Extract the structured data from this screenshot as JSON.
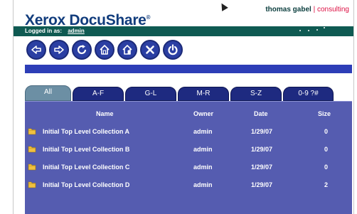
{
  "header": {
    "brand": "Xerox DocuShare",
    "brand_mark": "®",
    "tagline_name": "thomas gabel",
    "tagline_sep": " | ",
    "tagline_consulting": "consulting",
    "logged_in_label": "Logged in as:",
    "logged_in_user": "admin"
  },
  "toolbar": {
    "buttons": [
      {
        "name": "back-icon"
      },
      {
        "name": "forward-icon"
      },
      {
        "name": "refresh-icon"
      },
      {
        "name": "home-icon"
      },
      {
        "name": "personal-home-icon"
      },
      {
        "name": "close-icon"
      },
      {
        "name": "power-icon"
      }
    ]
  },
  "tabs": [
    "All",
    "A-F",
    "G-L",
    "M-R",
    "S-Z",
    "0-9 ?#"
  ],
  "table": {
    "columns": [
      "Name",
      "Owner",
      "Date",
      "Size"
    ],
    "rows": [
      {
        "name": "Initial Top Level Collection A",
        "owner": "admin",
        "date": "1/29/07",
        "size": "0"
      },
      {
        "name": "Initial Top Level Collection B",
        "owner": "admin",
        "date": "1/29/07",
        "size": "0"
      },
      {
        "name": "Initial Top Level Collection C",
        "owner": "admin",
        "date": "1/29/07",
        "size": "0"
      },
      {
        "name": "Initial Top Level Collection D",
        "owner": "admin",
        "date": "1/29/07",
        "size": "2"
      }
    ]
  },
  "colors": {
    "brand": "#113c7c",
    "teal_bar": "#0f5a52",
    "toolbar_button": "#2b3fa3",
    "content_bg": "#555cb0",
    "tab_bg": "#1e2a80",
    "tab_active": "#6c8fa4",
    "accent_red": "#dd1144"
  }
}
